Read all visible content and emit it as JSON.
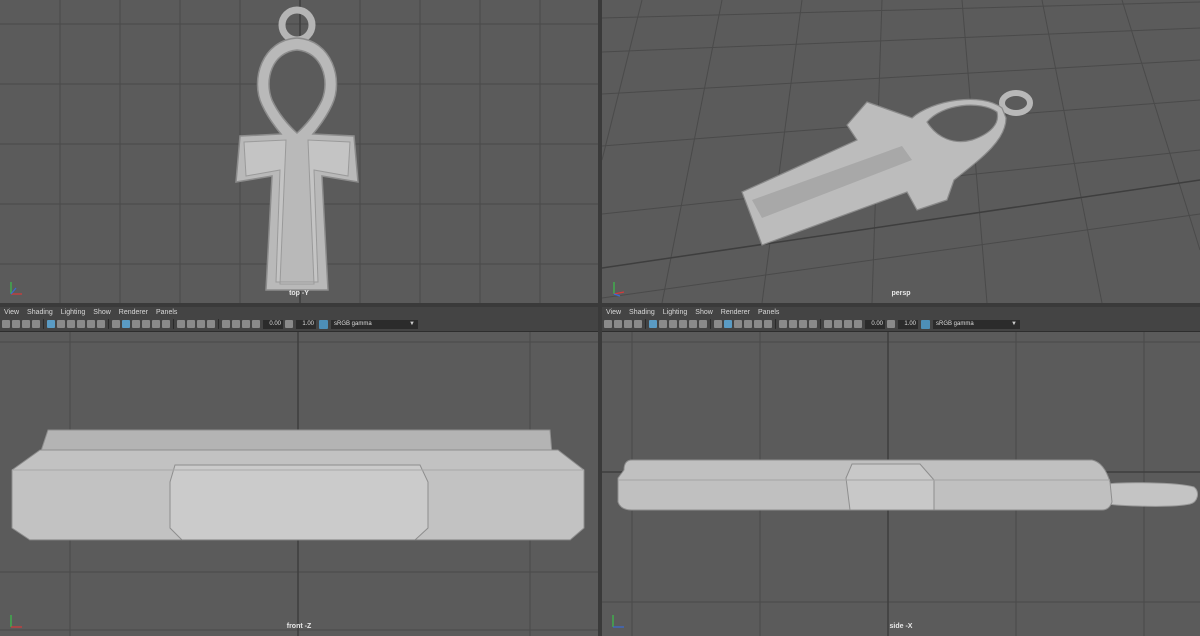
{
  "viewports": {
    "top": {
      "camera_label": "top -Y"
    },
    "persp": {
      "camera_label": "persp"
    },
    "front": {
      "camera_label": "front -Z"
    },
    "side": {
      "camera_label": "side -X"
    }
  },
  "panel_menu": {
    "view": "View",
    "shading": "Shading",
    "lighting": "Lighting",
    "show": "Show",
    "renderer": "Renderer",
    "panels": "Panels"
  },
  "panel_toolbar": {
    "exposure": "0.00",
    "gamma": "1.00",
    "color_space": "sRGB gamma"
  },
  "colors": {
    "viewport_bg": "#5b5b5b",
    "grid": "#4a4a4a",
    "model": "#bdbdbd",
    "accent": "#5a9bc4"
  },
  "icons": [
    "axis-gizmo-icon",
    "camera-icon",
    "grid-icon",
    "shading-icon",
    "gamma-icon",
    "dropdown-arrow-icon"
  ]
}
